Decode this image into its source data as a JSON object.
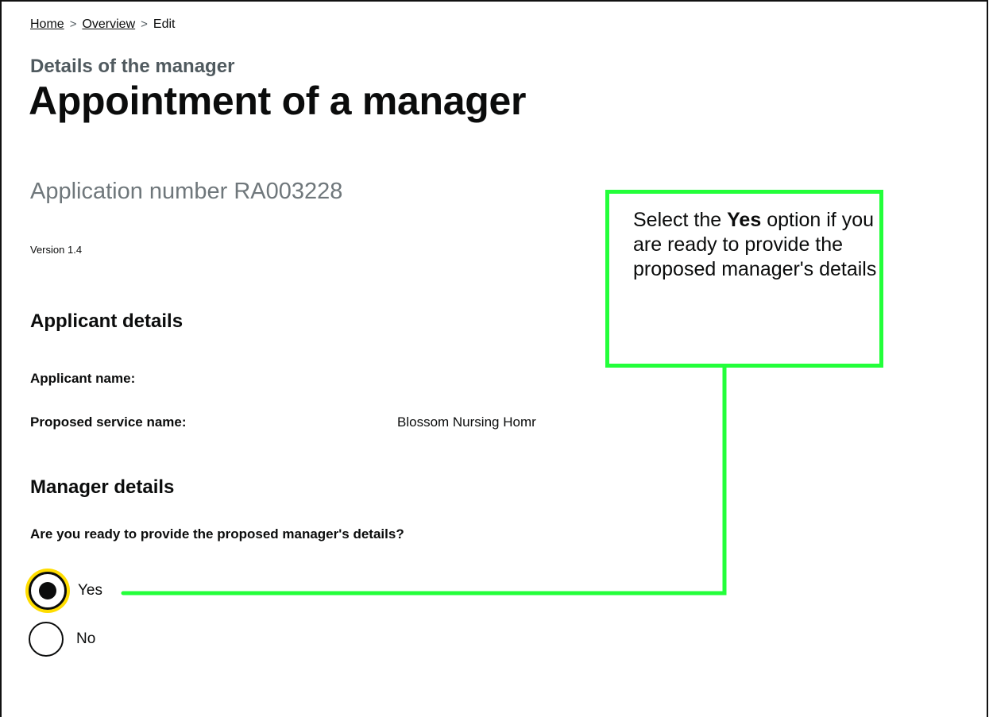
{
  "breadcrumb": {
    "home": "Home",
    "overview": "Overview",
    "current": "Edit",
    "separator": ">"
  },
  "caption": "Details of the manager",
  "title": "Appointment of a manager",
  "application_number": "Application number RA003228",
  "version": "Version 1.4",
  "applicant_section": {
    "heading": "Applicant details",
    "applicant_name_label": "Applicant name:",
    "service_name_label": "Proposed service name:",
    "service_name_value": "Blossom Nursing Homr"
  },
  "manager_section": {
    "heading": "Manager details",
    "question": "Are you ready to provide the proposed manager's details?",
    "options": [
      {
        "label": "Yes",
        "selected": true
      },
      {
        "label": "No",
        "selected": false
      }
    ]
  },
  "callout": {
    "text_before": "Select the ",
    "text_bold": "Yes",
    "text_after": " option if you are ready to provide the proposed manager's details"
  },
  "colors": {
    "callout_border": "#23ff3a",
    "focus_ring": "#ffdd00",
    "caption_gray": "#505a5f"
  }
}
